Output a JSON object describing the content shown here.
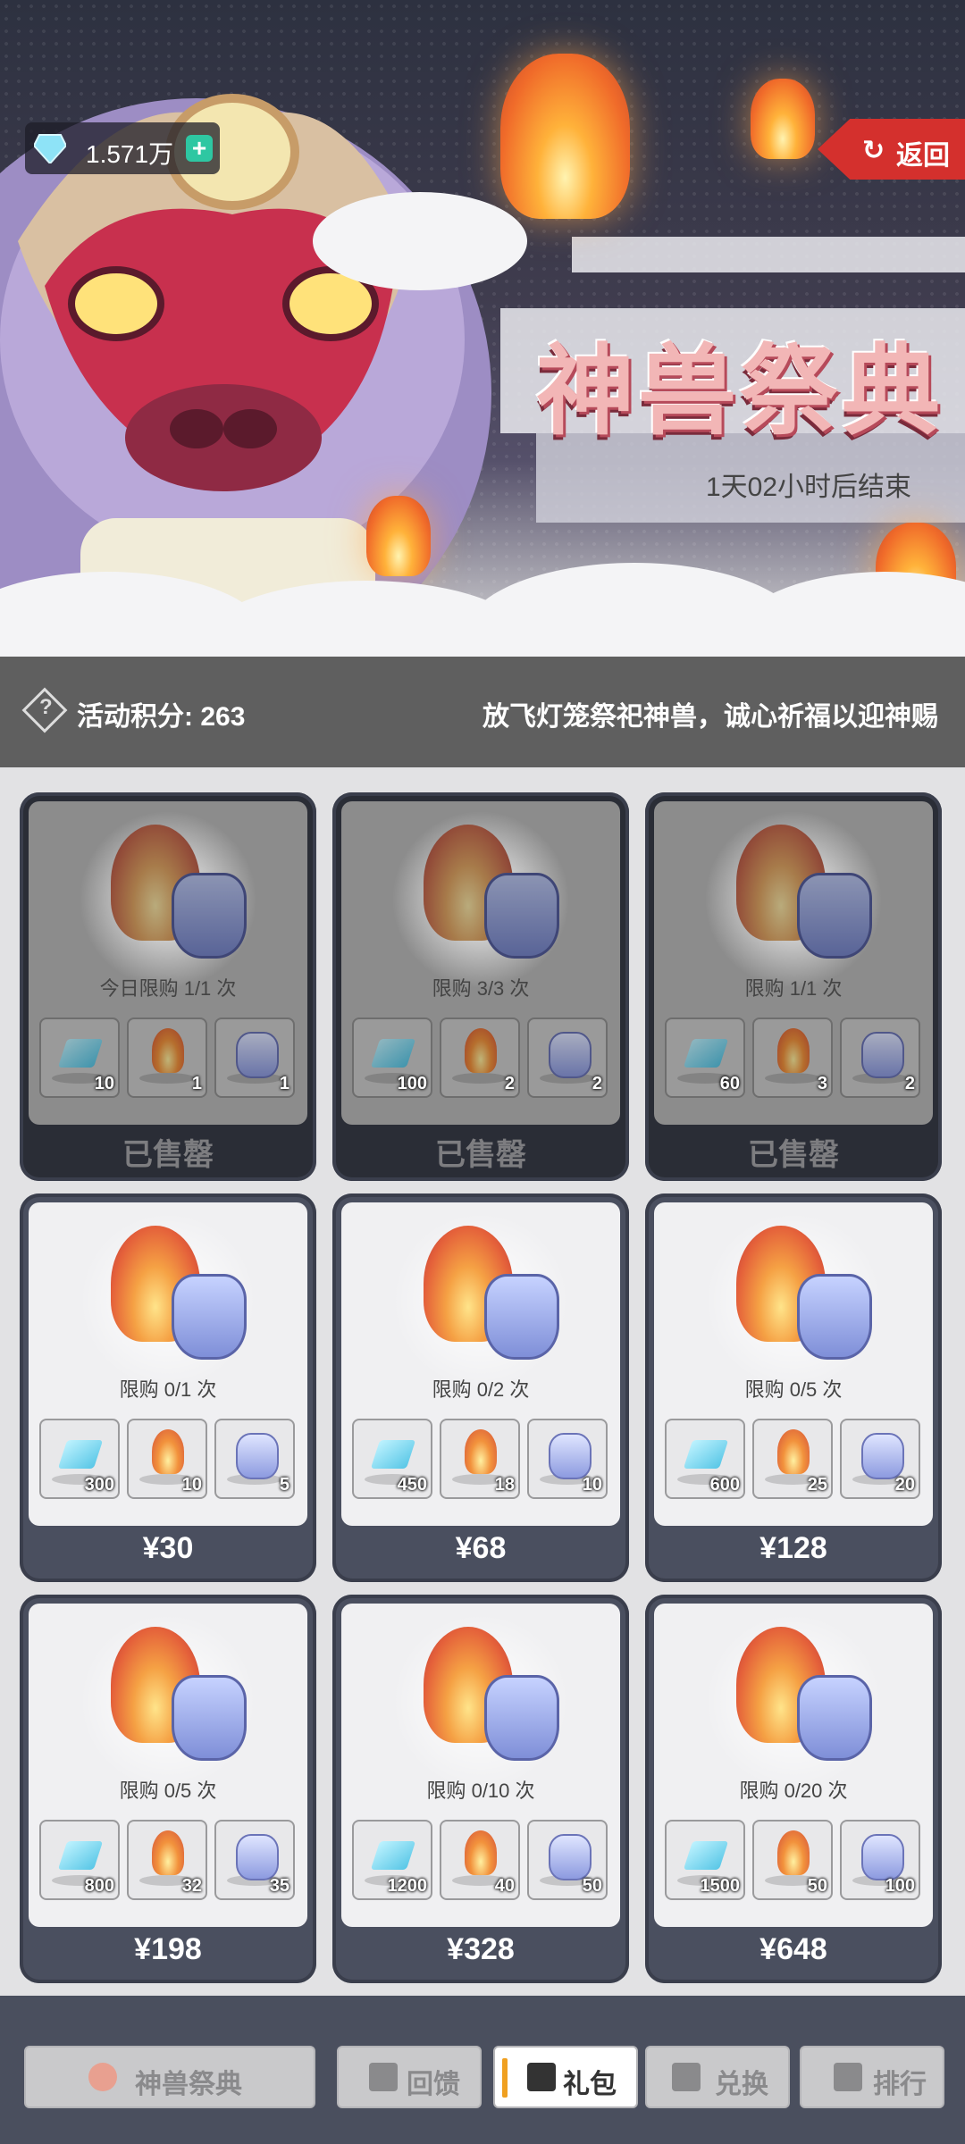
{
  "header": {
    "currency": {
      "icon": "gem-icon",
      "value": "1.571万"
    },
    "back_label": "返回",
    "event_title": "神兽祭典",
    "countdown": "1天02小时后结束"
  },
  "infobar": {
    "points_label": "活动积分: 263",
    "description": "放飞灯笼祭祀神兽，诚心祈福以迎神赐"
  },
  "packs": [
    {
      "limit": "今日限购 1/1 次",
      "items": [
        "10",
        "1",
        "1"
      ],
      "price": "已售罄",
      "sold_out": true
    },
    {
      "limit": "限购 3/3 次",
      "items": [
        "100",
        "2",
        "2"
      ],
      "price": "已售罄",
      "sold_out": true
    },
    {
      "limit": "限购 1/1 次",
      "items": [
        "60",
        "3",
        "2"
      ],
      "price": "已售罄",
      "sold_out": true
    },
    {
      "limit": "限购 0/1 次",
      "items": [
        "300",
        "10",
        "5"
      ],
      "price": "¥30",
      "sold_out": false
    },
    {
      "limit": "限购 0/2 次",
      "items": [
        "450",
        "18",
        "10"
      ],
      "price": "¥68",
      "sold_out": false
    },
    {
      "limit": "限购 0/5 次",
      "items": [
        "600",
        "25",
        "20"
      ],
      "price": "¥128",
      "sold_out": false
    },
    {
      "limit": "限购 0/5 次",
      "items": [
        "800",
        "32",
        "35"
      ],
      "price": "¥198",
      "sold_out": false
    },
    {
      "limit": "限购 0/10 次",
      "items": [
        "1200",
        "40",
        "50"
      ],
      "price": "¥328",
      "sold_out": false
    },
    {
      "limit": "限购 0/20 次",
      "items": [
        "1500",
        "50",
        "100"
      ],
      "price": "¥648",
      "sold_out": false
    }
  ],
  "bottom_nav": [
    {
      "label": "神兽祭典",
      "icon": "lantern-icon",
      "active": false
    },
    {
      "label": "回馈",
      "icon": "chest-icon",
      "active": false
    },
    {
      "label": "礼包",
      "icon": "gift-icon",
      "active": true
    },
    {
      "label": "兑换",
      "icon": "exchange-icon",
      "active": false
    },
    {
      "label": "排行",
      "icon": "rank-icon",
      "active": false
    }
  ]
}
